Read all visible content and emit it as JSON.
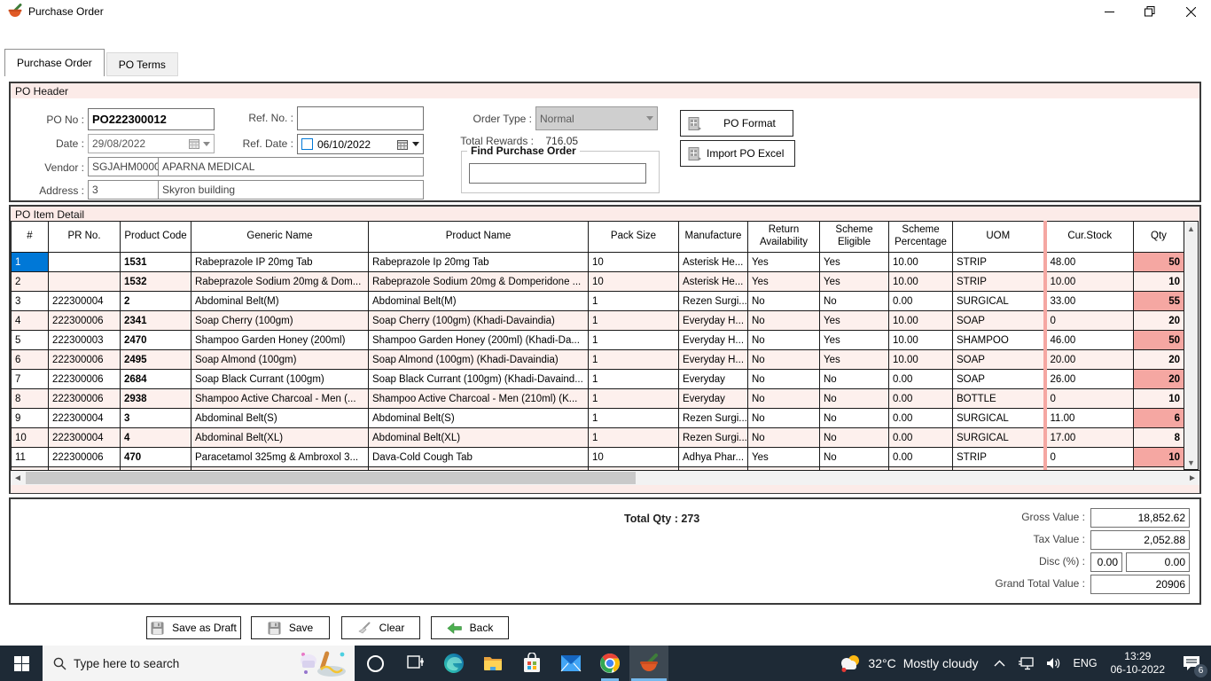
{
  "window": {
    "title": "Purchase Order"
  },
  "tabs": [
    {
      "label": "Purchase Order",
      "active": true
    },
    {
      "label": "PO Terms",
      "active": false
    }
  ],
  "po_header": {
    "title": "PO Header",
    "fields": {
      "po_no": {
        "label": "PO No :",
        "value": "PO222300012"
      },
      "date": {
        "label": "Date :",
        "value": "29/08/2022"
      },
      "vendor": {
        "label": "Vendor :",
        "code": "SGJAHM0000",
        "name": "APARNA MEDICAL"
      },
      "address": {
        "label": "Address :",
        "code": "3",
        "value": "Skyron building"
      },
      "ref_no": {
        "label": "Ref. No. :",
        "value": ""
      },
      "ref_date": {
        "label": "Ref. Date :",
        "value": "06/10/2022",
        "checked": false
      },
      "order_type": {
        "label": "Order Type :",
        "value": "Normal"
      },
      "total_rewards": {
        "label": "Total Rewards :",
        "value": "716.05"
      },
      "find_po": {
        "label": "Find Purchase Order",
        "value": ""
      }
    },
    "buttons": {
      "po_format": "PO Format",
      "import_po": "Import PO Excel"
    }
  },
  "po_item_detail": {
    "title": "PO Item Detail",
    "columns": [
      "#",
      "PR No.",
      "Product Code",
      "Generic Name",
      "Product Name",
      "Pack Size",
      "Manufacture",
      "Return Availability",
      "Scheme Eligible",
      "Scheme Percentage",
      "UOM",
      "Cur.Stock",
      "Qty"
    ],
    "rows": [
      {
        "cells": [
          "1",
          "",
          "1531",
          "Rabeprazole IP 20mg Tab",
          "Rabeprazole Ip 20mg Tab",
          "10",
          "Asterisk He...",
          "Yes",
          "Yes",
          "10.00",
          "STRIP",
          "48.00",
          "50"
        ],
        "selected": true,
        "qty_highlight": true
      },
      {
        "cells": [
          "2",
          "",
          "1532",
          "Rabeprazole Sodium 20mg & Dom...",
          "Rabeprazole Sodium 20mg & Domperidone ...",
          "10",
          "Asterisk He...",
          "Yes",
          "Yes",
          "10.00",
          "STRIP",
          "10.00",
          "10"
        ],
        "selected": false,
        "qty_highlight": false
      },
      {
        "cells": [
          "3",
          "222300004",
          "2",
          "Abdominal Belt(M)",
          "Abdominal Belt(M)",
          "1",
          "Rezen Surgi...",
          "No",
          "No",
          "0.00",
          "SURGICAL",
          "33.00",
          "55"
        ],
        "selected": false,
        "qty_highlight": true
      },
      {
        "cells": [
          "4",
          "222300006",
          "2341",
          "Soap Cherry (100gm)",
          "Soap Cherry (100gm) (Khadi-Davaindia)",
          "1",
          "Everyday H...",
          "No",
          "Yes",
          "10.00",
          "SOAP",
          "0",
          "20"
        ],
        "selected": false,
        "qty_highlight": false
      },
      {
        "cells": [
          "5",
          "222300003",
          "2470",
          "Shampoo Garden Honey (200ml)",
          "Shampoo Garden Honey (200ml) (Khadi-Da...",
          "1",
          "Everyday H...",
          "No",
          "Yes",
          "10.00",
          "SHAMPOO",
          "46.00",
          "50"
        ],
        "selected": false,
        "qty_highlight": true
      },
      {
        "cells": [
          "6",
          "222300006",
          "2495",
          "Soap Almond (100gm)",
          "Soap Almond (100gm) (Khadi-Davaindia)",
          "1",
          "Everyday H...",
          "No",
          "Yes",
          "10.00",
          "SOAP",
          "20.00",
          "20"
        ],
        "selected": false,
        "qty_highlight": false
      },
      {
        "cells": [
          "7",
          "222300006",
          "2684",
          "Soap Black Currant (100gm)",
          "Soap Black Currant (100gm) (Khadi-Davaind...",
          "1",
          "Everyday",
          "No",
          "No",
          "0.00",
          "SOAP",
          "26.00",
          "20"
        ],
        "selected": false,
        "qty_highlight": true
      },
      {
        "cells": [
          "8",
          "222300006",
          "2938",
          "Shampoo Active Charcoal - Men (...",
          "Shampoo Active Charcoal - Men (210ml) (K...",
          "1",
          "Everyday",
          "No",
          "No",
          "0.00",
          "BOTTLE",
          "0",
          "10"
        ],
        "selected": false,
        "qty_highlight": false
      },
      {
        "cells": [
          "9",
          "222300004",
          "3",
          "Abdominal Belt(S)",
          "Abdominal Belt(S)",
          "1",
          "Rezen Surgi...",
          "No",
          "No",
          "0.00",
          "SURGICAL",
          "11.00",
          "6"
        ],
        "selected": false,
        "qty_highlight": true
      },
      {
        "cells": [
          "10",
          "222300004",
          "4",
          "Abdominal Belt(XL)",
          "Abdominal Belt(XL)",
          "1",
          "Rezen Surgi...",
          "No",
          "No",
          "0.00",
          "SURGICAL",
          "17.00",
          "8"
        ],
        "selected": false,
        "qty_highlight": false
      },
      {
        "cells": [
          "11",
          "222300006",
          "470",
          "Paracetamol 325mg & Ambroxol 3...",
          "Dava-Cold Cough Tab",
          "10",
          "Adhya Phar...",
          "Yes",
          "No",
          "0.00",
          "STRIP",
          "0",
          "10"
        ],
        "selected": false,
        "qty_highlight": true
      }
    ]
  },
  "totals": {
    "total_qty_label": "Total Qty :",
    "total_qty": "273",
    "gross_value_label": "Gross Value  :",
    "gross_value": "18,852.62",
    "tax_value_label": "Tax Value  :",
    "tax_value": "2,052.88",
    "disc_label": "Disc (%)  :",
    "disc_pct": "0.00",
    "disc_value": "0.00",
    "grand_total_label": "Grand Total Value  :",
    "grand_total": "20906"
  },
  "footer": {
    "save_draft": "Save as Draft",
    "save": "Save",
    "clear": "Clear",
    "back": "Back"
  },
  "taskbar": {
    "search_placeholder": "Type here to search",
    "weather_temp": "32°C",
    "weather_desc": "Mostly cloudy",
    "language": "ENG",
    "time": "13:29",
    "date": "06-10-2022",
    "notification_count": "6"
  },
  "colors": {
    "selection_blue": "#0078d7",
    "row_pink": "#fdf0ed",
    "qty_highlight_salmon": "#f5a7a2",
    "section_strip_pink": "#fcebe8",
    "taskbar_dark": "#1e2a36"
  },
  "icons": [
    "mortar-pestle-app-icon",
    "minimize-icon",
    "restore-icon",
    "close-icon",
    "calendar-icon",
    "excel-icon",
    "save-floppy-icon",
    "clear-broom-icon",
    "back-arrow-icon",
    "windows-start-icon",
    "search-icon",
    "food-doodle",
    "cortana-icon",
    "task-view-icon",
    "edge-icon",
    "file-explorer-icon",
    "store-icon",
    "mail-icon",
    "chrome-icon",
    "weather-cloud-icon",
    "chevron-up-icon",
    "network-icon",
    "volume-icon",
    "language-indicator",
    "notification-icon"
  ]
}
